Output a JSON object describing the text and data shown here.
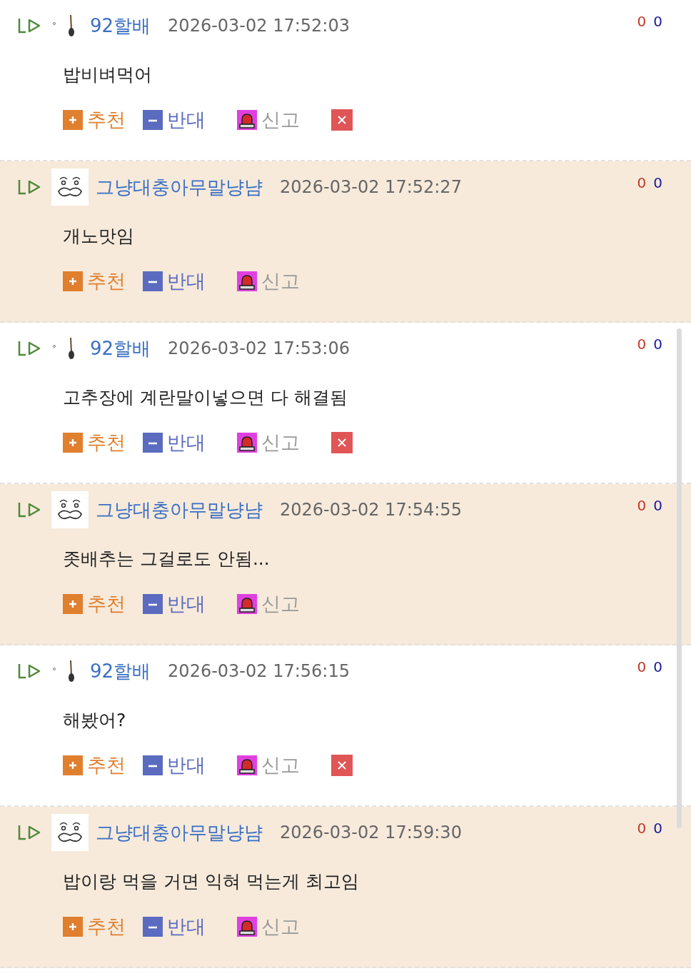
{
  "comments": [
    {
      "author": "92할배",
      "kind": "stick",
      "time": "2026-03-02 17:52:03",
      "body": "밥비벼먹어",
      "up_count": "0",
      "down_count": "0",
      "highlighted": false,
      "deletable": true,
      "recommend": "추천",
      "oppose": "반대",
      "report": "신고"
    },
    {
      "author": "그냥대충아무말냥냠",
      "kind": "face",
      "time": "2026-03-02 17:52:27",
      "body": "개노맛임",
      "up_count": "0",
      "down_count": "0",
      "highlighted": true,
      "deletable": false,
      "recommend": "추천",
      "oppose": "반대",
      "report": "신고"
    },
    {
      "author": "92할배",
      "kind": "stick",
      "time": "2026-03-02 17:53:06",
      "body": "고추장에 계란말이넣으면 다 해결됨",
      "up_count": "0",
      "down_count": "0",
      "highlighted": false,
      "deletable": true,
      "recommend": "추천",
      "oppose": "반대",
      "report": "신고"
    },
    {
      "author": "그냥대충아무말냥냠",
      "kind": "face",
      "time": "2026-03-02 17:54:55",
      "body": "좃배추는 그걸로도 안됨...",
      "up_count": "0",
      "down_count": "0",
      "highlighted": true,
      "deletable": false,
      "recommend": "추천",
      "oppose": "반대",
      "report": "신고"
    },
    {
      "author": "92할배",
      "kind": "stick",
      "time": "2026-03-02 17:56:15",
      "body": "해봤어?",
      "up_count": "0",
      "down_count": "0",
      "highlighted": false,
      "deletable": true,
      "recommend": "추천",
      "oppose": "반대",
      "report": "신고"
    },
    {
      "author": "그냥대충아무말냥냠",
      "kind": "face",
      "time": "2026-03-02 17:59:30",
      "body": "밥이랑 먹을 거면 익혀 먹는게 최고임",
      "up_count": "0",
      "down_count": "0",
      "highlighted": true,
      "deletable": false,
      "recommend": "추천",
      "oppose": "반대",
      "report": "신고"
    }
  ]
}
